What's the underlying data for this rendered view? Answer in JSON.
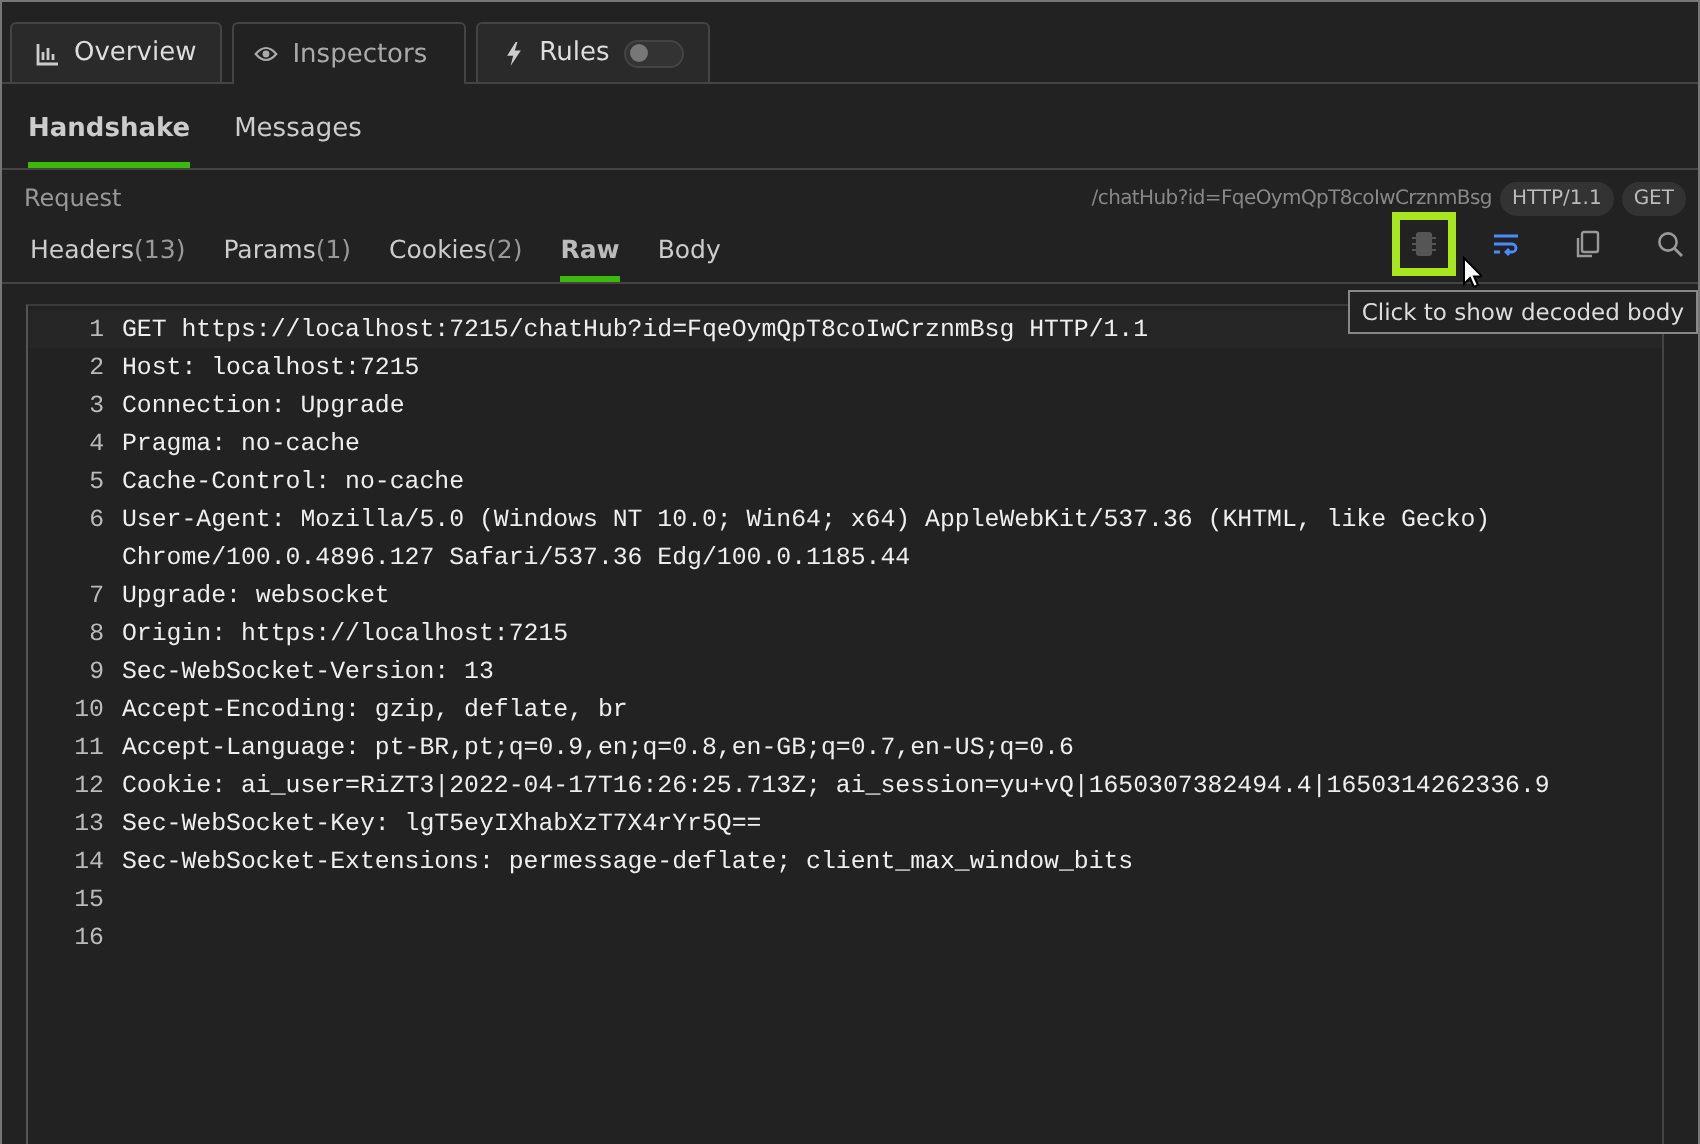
{
  "top_tabs": [
    {
      "kind": "overview",
      "label": "Overview",
      "selected": false
    },
    {
      "kind": "inspectors",
      "label": "Inspectors",
      "selected": true
    },
    {
      "kind": "rules",
      "label": "Rules",
      "selected": false,
      "toggle_on": false
    }
  ],
  "sub_tabs": [
    {
      "label": "Handshake",
      "selected": true
    },
    {
      "label": "Messages",
      "selected": false
    }
  ],
  "request": {
    "label": "Request",
    "path": "/chatHub?id=FqeOymQpT8coIwCrznmBsg",
    "badges": [
      "HTTP/1.1",
      "GET"
    ]
  },
  "view_tabs": [
    {
      "label": "Headers",
      "count": "(13)",
      "selected": false
    },
    {
      "label": "Params",
      "count": "(1)",
      "selected": false
    },
    {
      "label": "Cookies",
      "count": "(2)",
      "selected": false
    },
    {
      "label": "Raw",
      "selected": true
    },
    {
      "label": "Body",
      "selected": false
    }
  ],
  "toolbar": [
    {
      "kind": "decode",
      "active": false,
      "highlighted": true
    },
    {
      "kind": "wrap",
      "active": true
    },
    {
      "kind": "copy",
      "active": false
    },
    {
      "kind": "search",
      "active": false
    }
  ],
  "tooltip": "Click to show decoded body",
  "lines": [
    {
      "number": "1",
      "text": "GET https://localhost:7215/chatHub?id=FqeOymQpT8coIwCrznmBsg HTTP/1.1",
      "current": true
    },
    {
      "number": "2",
      "text": "Host: localhost:7215"
    },
    {
      "number": "3",
      "text": "Connection: Upgrade"
    },
    {
      "number": "4",
      "text": "Pragma: no-cache"
    },
    {
      "number": "5",
      "text": "Cache-Control: no-cache"
    },
    {
      "number": "6",
      "text": "User-Agent: Mozilla/5.0 (Windows NT 10.0; Win64; x64) AppleWebKit/537.36 (KHTML, like Gecko)"
    },
    {
      "text": "Chrome/100.0.4896.127 Safari/537.36 Edg/100.0.1185.44"
    },
    {
      "number": "7",
      "text": "Upgrade: websocket"
    },
    {
      "number": "8",
      "text": "Origin: https://localhost:7215"
    },
    {
      "number": "9",
      "text": "Sec-WebSocket-Version: 13"
    },
    {
      "number": "10",
      "text": "Accept-Encoding: gzip, deflate, br"
    },
    {
      "number": "11",
      "text": "Accept-Language: pt-BR,pt;q=0.9,en;q=0.8,en-GB;q=0.7,en-US;q=0.6"
    },
    {
      "number": "12",
      "text": "Cookie: ai_user=RiZT3|2022-04-17T16:26:25.713Z; ai_session=yu+vQ|1650307382494.4|1650314262336.9"
    },
    {
      "number": "13",
      "text": "Sec-WebSocket-Key: lgT5eyIXhabXzT7X4rYr5Q=="
    },
    {
      "number": "14",
      "text": "Sec-WebSocket-Extensions: permessage-deflate; client_max_window_bits"
    },
    {
      "number": "15"
    },
    {
      "number": "16"
    }
  ]
}
